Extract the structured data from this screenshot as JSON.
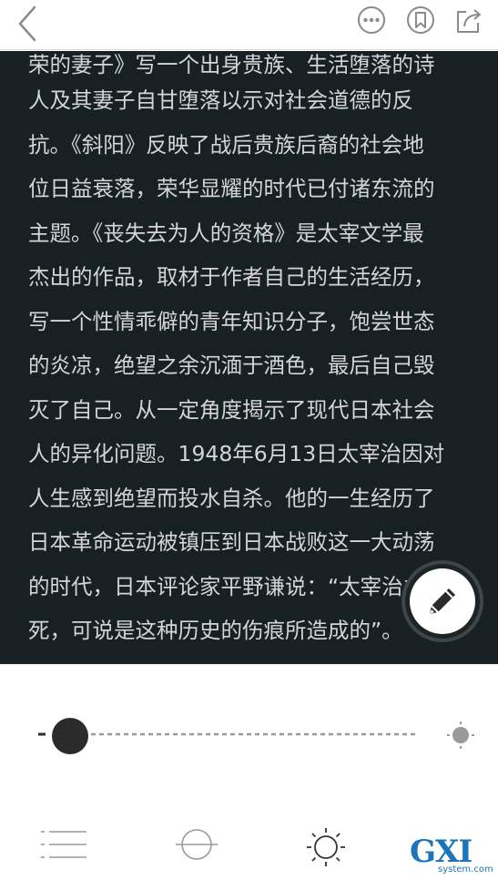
{
  "book_text": {
    "lines": [
      "荣的妻子》写一个出身贵族、生活堕落的诗",
      "人及其妻子自甘堕落以示对社会道德的反",
      "抗。《斜阳》反映了战后贵族后裔的社会地",
      "位日益衰落，荣华显耀的时代已付诸东流的",
      "主题。《丧失去为人的资格》是太宰文学最",
      "杰出的作品，取材于作者自己的生活经历，",
      "写一个性情乖僻的青年知识分子，饱尝世态",
      "的炎凉，绝望之余沉湎于酒色，最后自己毁",
      "灭了自己。从一定角度揭示了现代日本社会",
      "人的异化问题。1948年6月13日太宰治因对",
      "人生感到绝望而投水自杀。他的一生经历了",
      "日本革命运动被镇压到日本战败这一大动荡",
      "的时代，日本评论家平野谦说：“太宰治之",
      "死，可说是这种历史的伤痕所造成的”。"
    ]
  },
  "brightness": {
    "level": 0.06
  },
  "watermark": {
    "main": "GXI网",
    "sub": "system.com"
  },
  "icons": {
    "back": "chevron-left-icon",
    "more": "more-dots-icon",
    "bookmark": "bookmark-icon",
    "share": "share-icon",
    "edit": "pencil-icon",
    "toc": "list-icon",
    "progress": "circle-line-icon",
    "brightness": "sun-icon"
  },
  "colors": {
    "reader_bg": "#172022",
    "reader_text": "#d5d5d5",
    "accent_watermark": "#1c75bc"
  }
}
